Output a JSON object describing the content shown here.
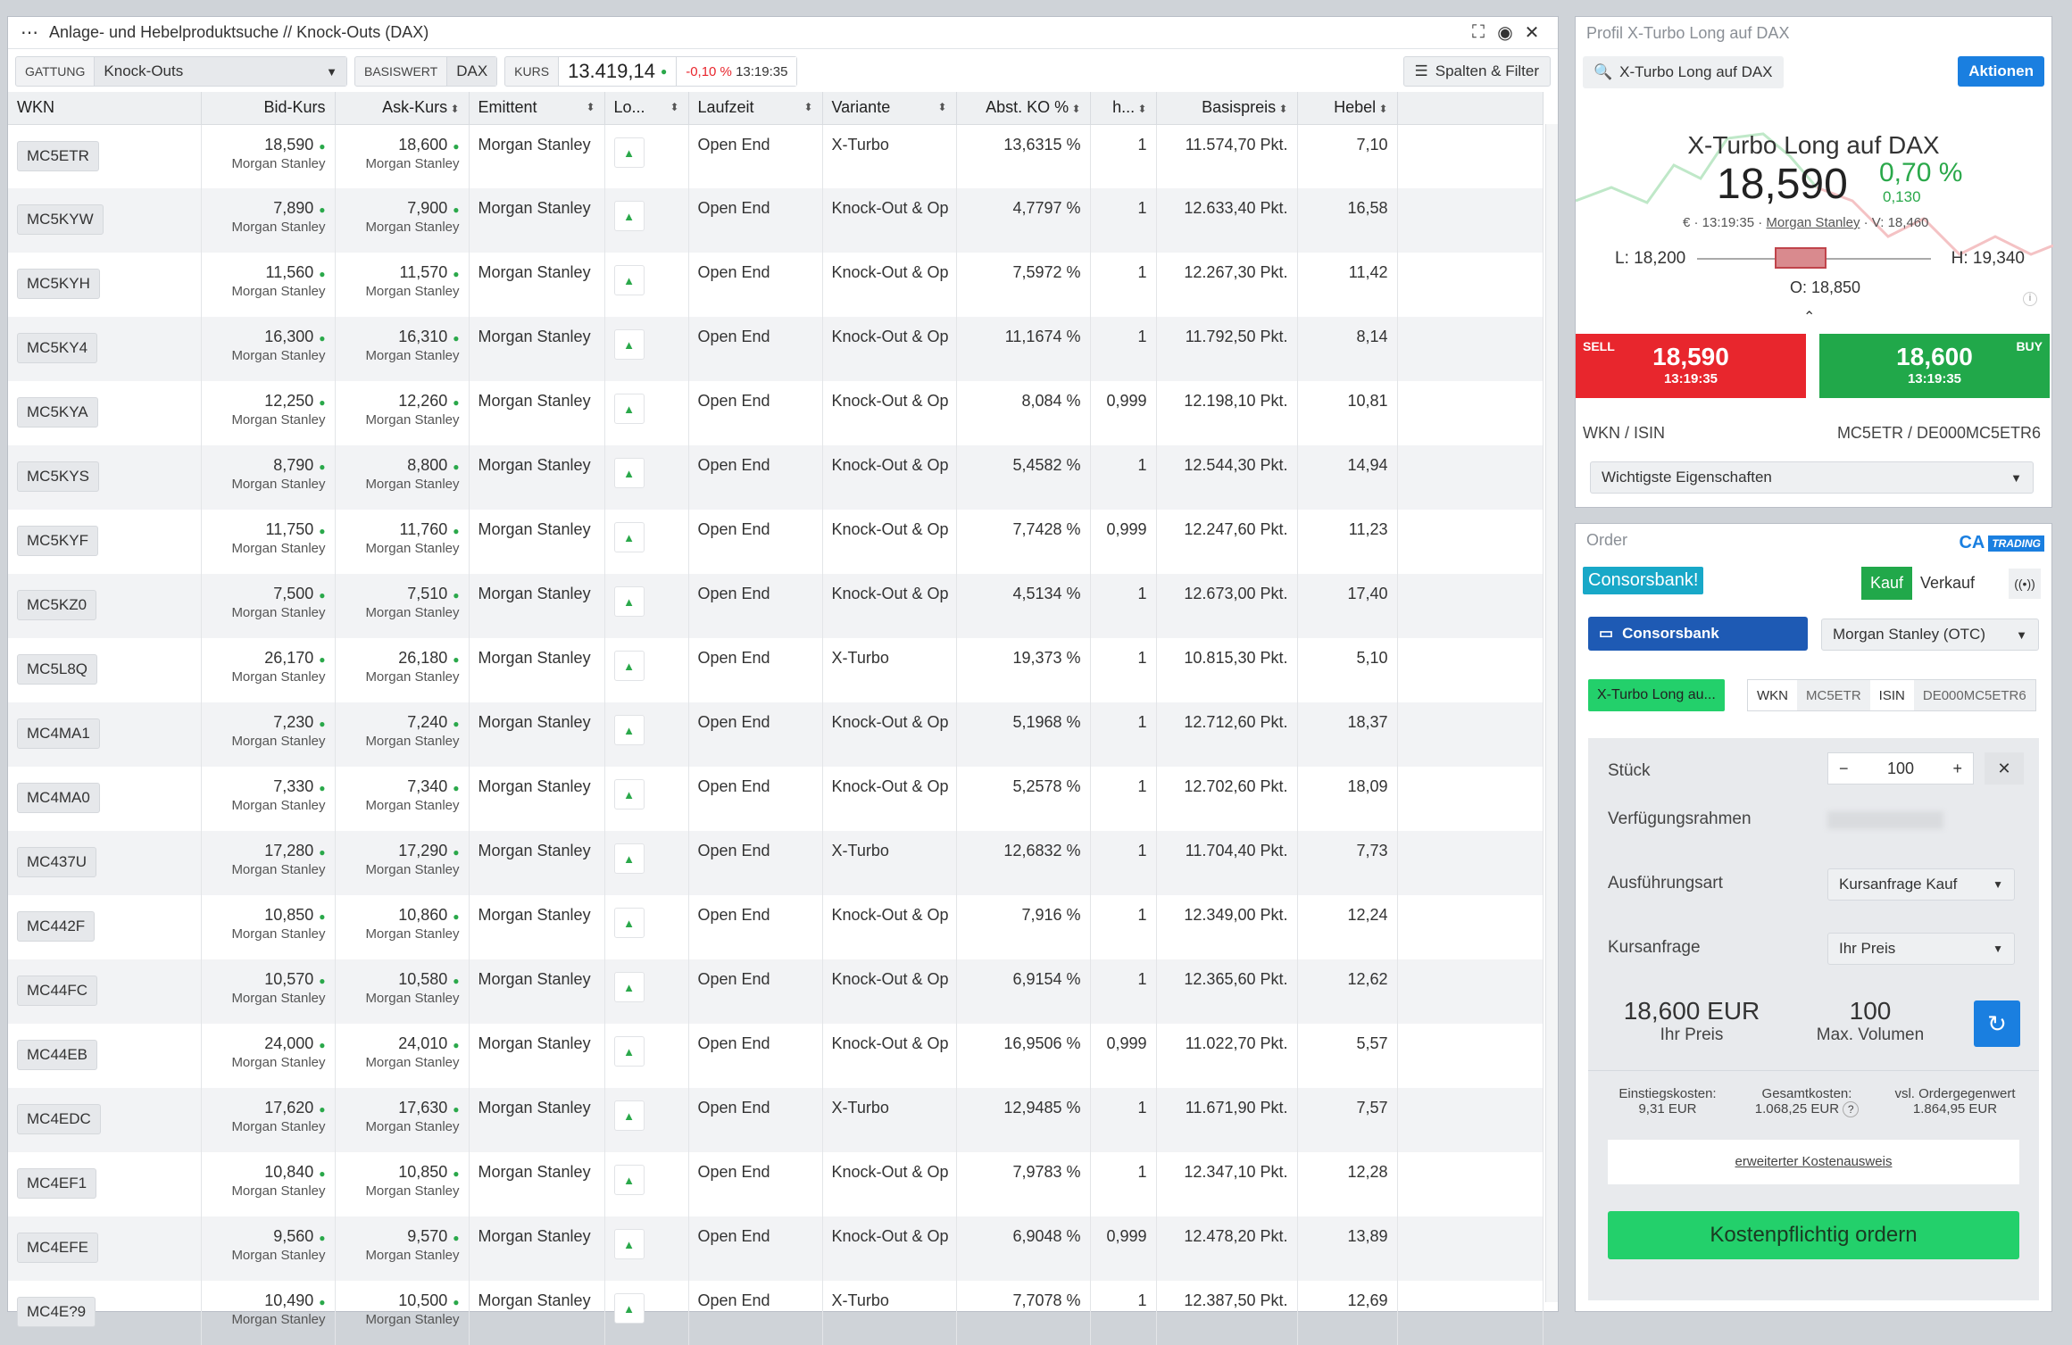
{
  "window": {
    "menu": "⋯",
    "title": "Anlage- und Hebelproduktsuche // Knock-Outs (DAX)"
  },
  "toolbar": {
    "gattung_label": "GATTUNG",
    "gattung_value": "Knock-Outs",
    "basiswert_label": "BASISWERT",
    "basiswert_value": "DAX",
    "kurs_label": "KURS",
    "kurs_value": "13.419,14",
    "change": "-0,10 %",
    "time": "13:19:35",
    "spalten_label": "Spalten & Filter"
  },
  "columns": [
    "WKN",
    "Bid-Kurs",
    "Ask-Kurs",
    "Emittent",
    "Lo...",
    "Laufzeit",
    "Variante",
    "Abst. KO %",
    "h...",
    "Basispreis",
    "Hebel"
  ],
  "rows": [
    {
      "wkn": "MC5ETR",
      "bid": "18,590",
      "ask": "18,600",
      "issuer": "Morgan Stanley",
      "lz": "Open End",
      "var": "X-Turbo",
      "ko": "13,6315 %",
      "h": "1",
      "bp": "11.574,70 Pkt.",
      "hebel": "7,10"
    },
    {
      "wkn": "MC5KYW",
      "bid": "7,890",
      "ask": "7,900",
      "issuer": "Morgan Stanley",
      "lz": "Open End",
      "var": "Knock-Out & Op",
      "ko": "4,7797 %",
      "h": "1",
      "bp": "12.633,40 Pkt.",
      "hebel": "16,58"
    },
    {
      "wkn": "MC5KYH",
      "bid": "11,560",
      "ask": "11,570",
      "issuer": "Morgan Stanley",
      "lz": "Open End",
      "var": "Knock-Out & Op",
      "ko": "7,5972 %",
      "h": "1",
      "bp": "12.267,30 Pkt.",
      "hebel": "11,42"
    },
    {
      "wkn": "MC5KY4",
      "bid": "16,300",
      "ask": "16,310",
      "issuer": "Morgan Stanley",
      "lz": "Open End",
      "var": "Knock-Out & Op",
      "ko": "11,1674 %",
      "h": "1",
      "bp": "11.792,50 Pkt.",
      "hebel": "8,14"
    },
    {
      "wkn": "MC5KYA",
      "bid": "12,250",
      "ask": "12,260",
      "issuer": "Morgan Stanley",
      "lz": "Open End",
      "var": "Knock-Out & Op",
      "ko": "8,084 %",
      "h": "0,999",
      "bp": "12.198,10 Pkt.",
      "hebel": "10,81"
    },
    {
      "wkn": "MC5KYS",
      "bid": "8,790",
      "ask": "8,800",
      "issuer": "Morgan Stanley",
      "lz": "Open End",
      "var": "Knock-Out & Op",
      "ko": "5,4582 %",
      "h": "1",
      "bp": "12.544,30 Pkt.",
      "hebel": "14,94"
    },
    {
      "wkn": "MC5KYF",
      "bid": "11,750",
      "ask": "11,760",
      "issuer": "Morgan Stanley",
      "lz": "Open End",
      "var": "Knock-Out & Op",
      "ko": "7,7428 %",
      "h": "0,999",
      "bp": "12.247,60 Pkt.",
      "hebel": "11,23"
    },
    {
      "wkn": "MC5KZ0",
      "bid": "7,500",
      "ask": "7,510",
      "issuer": "Morgan Stanley",
      "lz": "Open End",
      "var": "Knock-Out & Op",
      "ko": "4,5134 %",
      "h": "1",
      "bp": "12.673,00 Pkt.",
      "hebel": "17,40"
    },
    {
      "wkn": "MC5L8Q",
      "bid": "26,170",
      "ask": "26,180",
      "issuer": "Morgan Stanley",
      "lz": "Open End",
      "var": "X-Turbo",
      "ko": "19,373 %",
      "h": "1",
      "bp": "10.815,30 Pkt.",
      "hebel": "5,10"
    },
    {
      "wkn": "MC4MA1",
      "bid": "7,230",
      "ask": "7,240",
      "issuer": "Morgan Stanley",
      "lz": "Open End",
      "var": "Knock-Out & Op",
      "ko": "5,1968 %",
      "h": "1",
      "bp": "12.712,60 Pkt.",
      "hebel": "18,37"
    },
    {
      "wkn": "MC4MA0",
      "bid": "7,330",
      "ask": "7,340",
      "issuer": "Morgan Stanley",
      "lz": "Open End",
      "var": "Knock-Out & Op",
      "ko": "5,2578 %",
      "h": "1",
      "bp": "12.702,60 Pkt.",
      "hebel": "18,09"
    },
    {
      "wkn": "MC437U",
      "bid": "17,280",
      "ask": "17,290",
      "issuer": "Morgan Stanley",
      "lz": "Open End",
      "var": "X-Turbo",
      "ko": "12,6832 %",
      "h": "1",
      "bp": "11.704,40 Pkt.",
      "hebel": "7,73"
    },
    {
      "wkn": "MC442F",
      "bid": "10,850",
      "ask": "10,860",
      "issuer": "Morgan Stanley",
      "lz": "Open End",
      "var": "Knock-Out & Op",
      "ko": "7,916 %",
      "h": "1",
      "bp": "12.349,00 Pkt.",
      "hebel": "12,24"
    },
    {
      "wkn": "MC44FC",
      "bid": "10,570",
      "ask": "10,580",
      "issuer": "Morgan Stanley",
      "lz": "Open End",
      "var": "Knock-Out & Op",
      "ko": "6,9154 %",
      "h": "1",
      "bp": "12.365,60 Pkt.",
      "hebel": "12,62"
    },
    {
      "wkn": "MC44EB",
      "bid": "24,000",
      "ask": "24,010",
      "issuer": "Morgan Stanley",
      "lz": "Open End",
      "var": "Knock-Out & Op",
      "ko": "16,9506 %",
      "h": "0,999",
      "bp": "11.022,70 Pkt.",
      "hebel": "5,57"
    },
    {
      "wkn": "MC4EDC",
      "bid": "17,620",
      "ask": "17,630",
      "issuer": "Morgan Stanley",
      "lz": "Open End",
      "var": "X-Turbo",
      "ko": "12,9485 %",
      "h": "1",
      "bp": "11.671,90 Pkt.",
      "hebel": "7,57"
    },
    {
      "wkn": "MC4EF1",
      "bid": "10,840",
      "ask": "10,850",
      "issuer": "Morgan Stanley",
      "lz": "Open End",
      "var": "Knock-Out & Op",
      "ko": "7,9783 %",
      "h": "1",
      "bp": "12.347,10 Pkt.",
      "hebel": "12,28"
    },
    {
      "wkn": "MC4EFE",
      "bid": "9,560",
      "ask": "9,570",
      "issuer": "Morgan Stanley",
      "lz": "Open End",
      "var": "Knock-Out & Op",
      "ko": "6,9048 %",
      "h": "0,999",
      "bp": "12.478,20 Pkt.",
      "hebel": "13,89"
    },
    {
      "wkn": "MC4E?9",
      "bid": "10,490",
      "ask": "10,500",
      "issuer": "Morgan Stanley",
      "lz": "Open End",
      "var": "X-Turbo",
      "ko": "7,7078 %",
      "h": "1",
      "bp": "12.387,50 Pkt.",
      "hebel": "12,69"
    }
  ],
  "profile": {
    "header": "Profil X-Turbo Long auf DAX",
    "search": "X-Turbo Long auf DAX",
    "aktionen": "Aktionen",
    "name": "X-Turbo Long auf DAX",
    "price": "18,590",
    "pct": "0,70 %",
    "abs": "0,130",
    "meta_time": "€ · 13:19:35 ·",
    "meta_issuer": "Morgan Stanley",
    "meta_v": "· V: 18,460",
    "low": "L: 18,200",
    "high": "H: 19,340",
    "open": "O: 18,850",
    "sell_tag": "SELL",
    "sell_price": "18,590",
    "sell_time": "13:19:35",
    "buy_tag": "BUY",
    "buy_price": "18,600",
    "buy_time": "13:19:35",
    "wkn_label": "WKN / ISIN",
    "wkn_value": "MC5ETR / DE000MC5ETR6",
    "props": "Wichtigste Eigenschaften"
  },
  "order": {
    "title": "Order",
    "brand_badge": "TRADING",
    "bank": "Consorsbank!",
    "kauf": "Kauf",
    "verkauf": "Verkauf",
    "account": "Consorsbank",
    "venue": "Morgan Stanley (OTC)",
    "product": "X-Turbo Long au...",
    "wkn_l": "WKN",
    "wkn_v": "MC5ETR",
    "isin_l": "ISIN",
    "isin_v": "DE000MC5ETR6",
    "stueck_l": "Stück",
    "stueck_v": "100",
    "vr_l": "Verfügungsrahmen",
    "art_l": "Ausführungsart",
    "art_v": "Kursanfrage Kauf",
    "kursanfrage_l": "Kursanfrage",
    "kursanfrage_v": "Ihr Preis",
    "preis": "18,600 EUR",
    "preis_l": "Ihr Preis",
    "vol": "100",
    "vol_l": "Max. Volumen",
    "k1_l": "Einstiegskosten:",
    "k1_v": "9,31 EUR",
    "k2_l": "Gesamtkosten:",
    "k2_v": "1.068,25 EUR",
    "k3_l": "vsl. Ordergegenwert",
    "k3_v": "1.864,95 EUR",
    "ext": "erweiterter Kostenausweis",
    "submit": "Kostenpflichtig ordern"
  },
  "colors": {
    "accent": "#1a7fe0",
    "sell": "#e8262d",
    "buy": "#21a84a",
    "submit": "#23d06b"
  }
}
